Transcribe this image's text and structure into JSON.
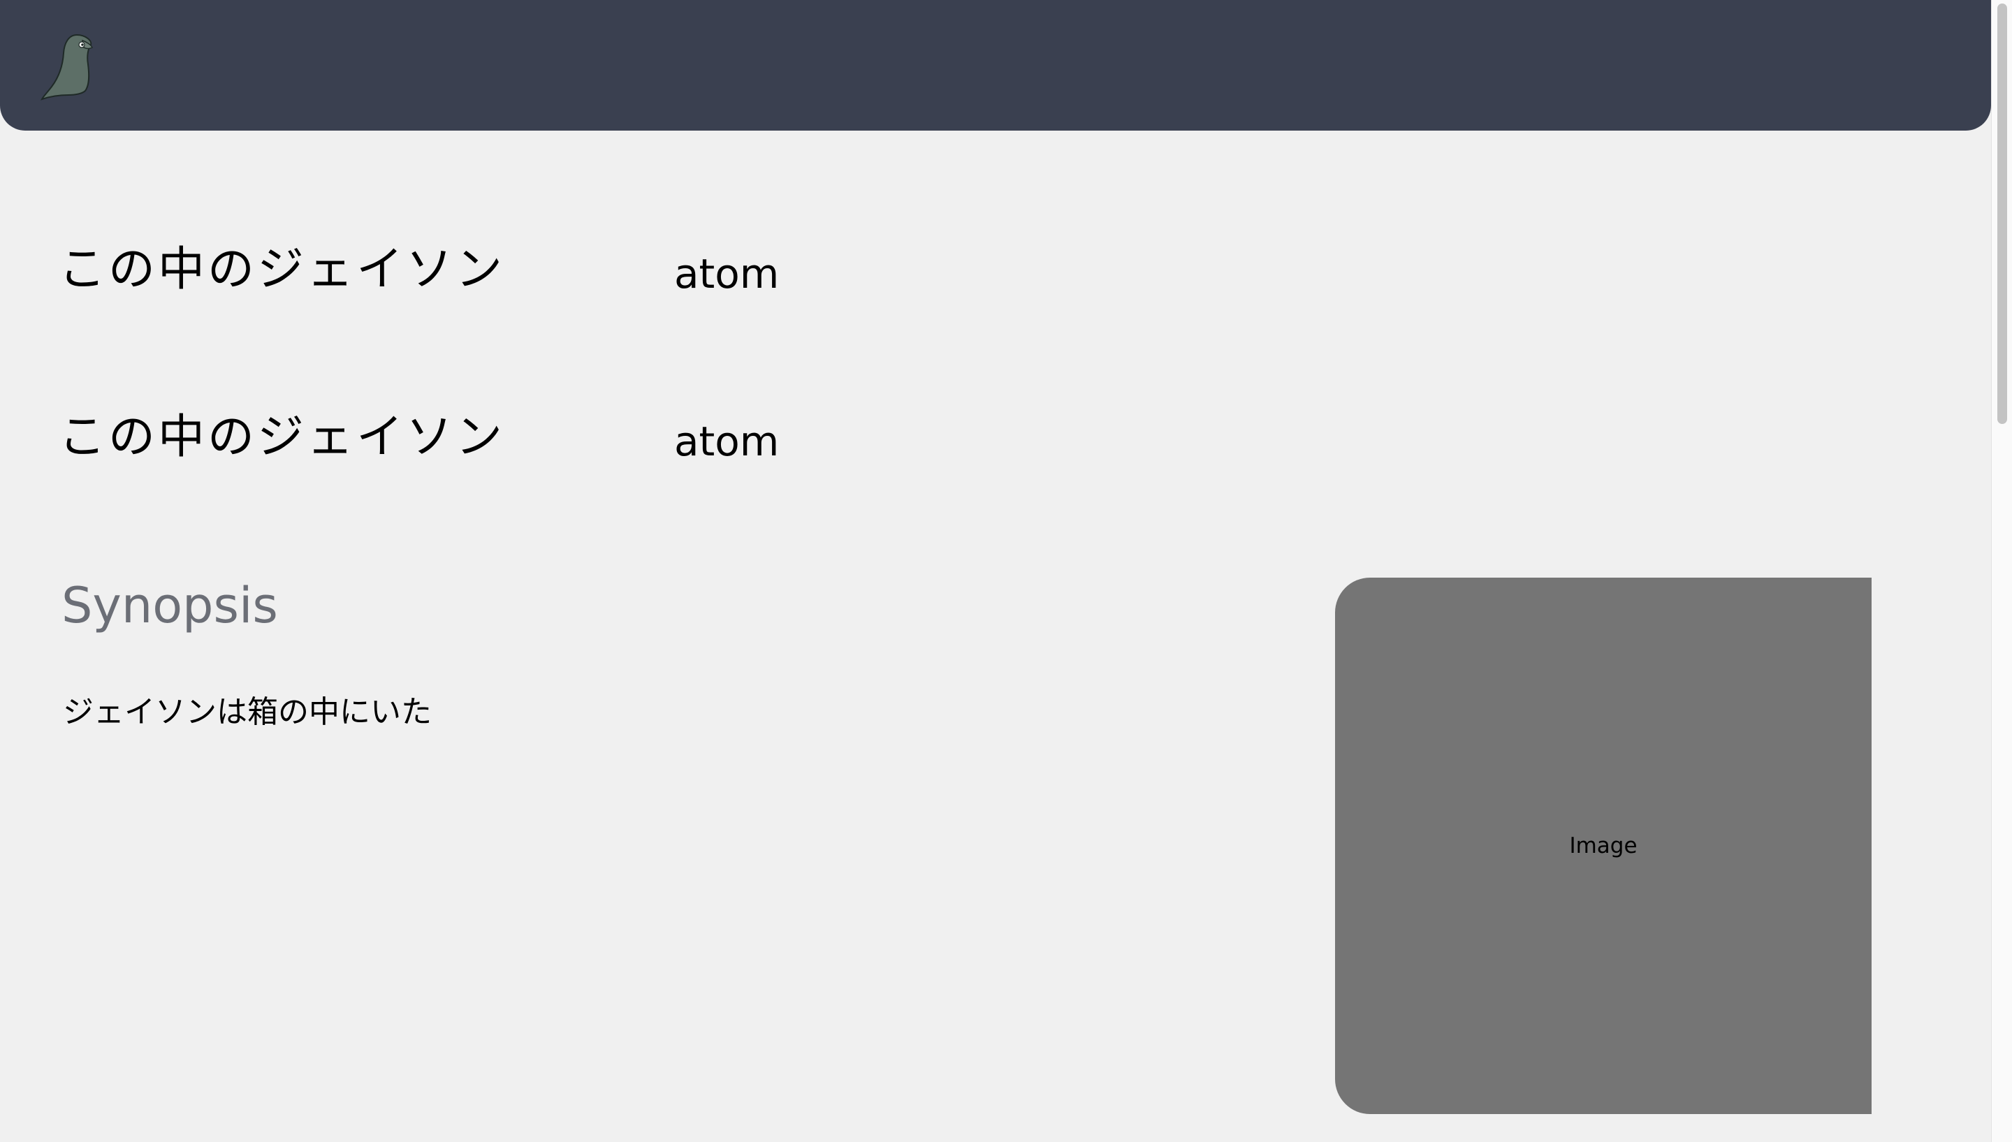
{
  "header": {
    "logo_icon": "penguin-logo-icon",
    "background_color": "#3a4050"
  },
  "titles": [
    {
      "japanese": "この中のジェイソン",
      "english": "atom"
    },
    {
      "japanese": "この中のジェイソン",
      "english": "atom"
    }
  ],
  "synopsis": {
    "heading": "Synopsis",
    "text": "ジェイソンは箱の中にいた"
  },
  "image_placeholder": {
    "label": "Image",
    "color": "#757575"
  }
}
